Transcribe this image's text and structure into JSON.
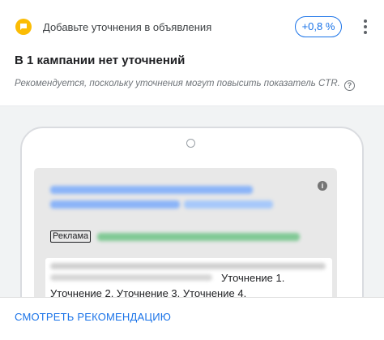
{
  "header": {
    "recommendation_type": "Добавьте уточнения в объявления",
    "uplift": "+0,8 %"
  },
  "title": "В 1 кампании нет уточнений",
  "description": "Рекомендуется, поскольку уточнения могут повысить показатель CTR.",
  "preview": {
    "ad_label": "Реклама",
    "callouts_line1": "Уточнение 1.",
    "callouts_line2": "Уточнение 2. Уточнение 3. Уточнение 4."
  },
  "footer": {
    "cta_label": "СМОТРЕТЬ РЕКОМЕНДАЦИЮ"
  },
  "colors": {
    "accent": "#1a73e8",
    "icon_yellow": "#fbbc04",
    "placeholder_blue": "#8ab4f8",
    "placeholder_green": "#81c995"
  },
  "icons": {
    "recommendation": "chat-bubble-icon",
    "more": "more-vert-icon",
    "help": "help-circle-icon",
    "info": "info-icon"
  }
}
